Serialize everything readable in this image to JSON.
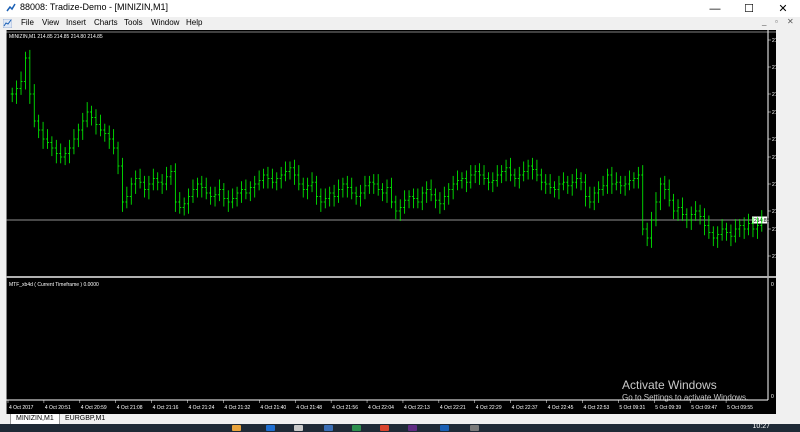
{
  "window": {
    "title": "88008: Tradize-Demo - [MINIZIN,M1]",
    "buttons": {
      "minimize": "—",
      "maximize": "☐",
      "close": "✕"
    }
  },
  "menu": {
    "items": [
      "File",
      "View",
      "Insert",
      "Charts",
      "Tools",
      "Window",
      "Help"
    ],
    "mdi": {
      "minimize": "_",
      "restore": "▫",
      "close": "✕"
    }
  },
  "chart": {
    "header": "MINIZIN,M1  214.85 214.85 214.80 214.85",
    "current_price": "214.85",
    "indicator_label": "MTF_xb4d ( Current Timeframe ) 0.0000",
    "indicator_scale_top": "0",
    "indicator_scale_bottom": "0",
    "time_labels": [
      "4 Oct 2017",
      "4 Oct 20:51",
      "4 Oct 20:59",
      "4 Oct 21:08",
      "4 Oct 21:16",
      "4 Oct 21:24",
      "4 Oct 21:32",
      "4 Oct 21:40",
      "4 Oct 21:48",
      "4 Oct 21:56",
      "4 Oct 22:04",
      "4 Oct 22:13",
      "4 Oct 22:21",
      "4 Oct 22:29",
      "4 Oct 22:37",
      "4 Oct 22:45",
      "4 Oct 22:53",
      "5 Oct 09:31",
      "5 Oct 09:39",
      "5 Oct 09:47",
      "5 Oct 09:55"
    ],
    "colors": {
      "bars": "#00ff00",
      "background": "#000000",
      "text": "#ffffff",
      "price_line": "#c0c0c0"
    }
  },
  "chart_data": {
    "type": "ohlc",
    "price_ticks": [
      "215.85",
      "215.70",
      "215.55",
      "215.45",
      "215.30",
      "215.20",
      "215.05",
      "214.90",
      "214.80",
      "214.65"
    ],
    "y_range": [
      214.55,
      215.85
    ],
    "closes": [
      215.55,
      215.58,
      215.62,
      215.75,
      215.55,
      215.4,
      215.35,
      215.3,
      215.28,
      215.25,
      215.22,
      215.2,
      215.22,
      215.25,
      215.3,
      215.35,
      215.4,
      215.45,
      215.42,
      215.38,
      215.35,
      215.33,
      215.3,
      215.25,
      215.15,
      214.95,
      214.98,
      215.05,
      215.08,
      215.06,
      215.02,
      215.05,
      215.08,
      215.06,
      215.05,
      215.09,
      215.12,
      214.95,
      214.92,
      214.94,
      214.98,
      215.02,
      215.05,
      215.03,
      215.0,
      214.98,
      214.99,
      215.02,
      214.97,
      214.95,
      214.97,
      215.0,
      215.02,
      215.0,
      215.03,
      215.05,
      215.07,
      215.1,
      215.08,
      215.06,
      215.08,
      215.1,
      215.12,
      215.14,
      215.1,
      215.05,
      215.02,
      215.04,
      215.06,
      214.98,
      214.95,
      214.97,
      215.0,
      214.98,
      215.02,
      215.05,
      215.03,
      215.0,
      214.98,
      215.0,
      215.04,
      215.06,
      215.05,
      215.02,
      215.0,
      215.03,
      214.95,
      214.9,
      214.92,
      214.96,
      214.98,
      214.97,
      214.95,
      215.0,
      215.02,
      214.99,
      214.96,
      214.94,
      214.98,
      215.02,
      215.05,
      215.07,
      215.08,
      215.06,
      215.1,
      215.12,
      215.1,
      215.08,
      215.06,
      215.07,
      215.1,
      215.12,
      215.14,
      215.1,
      215.08,
      215.1,
      215.12,
      215.15,
      215.13,
      215.1,
      215.06,
      215.05,
      215.03,
      215.02,
      215.05,
      215.06,
      215.04,
      215.06,
      215.08,
      215.06,
      214.98,
      214.95,
      215.0,
      215.02,
      215.04,
      215.1,
      215.05,
      215.06,
      215.04,
      215.05,
      215.07,
      215.08,
      215.1,
      214.8,
      214.75,
      214.85,
      214.95,
      215.05,
      215.02,
      214.96,
      214.9,
      214.92,
      214.88,
      214.85,
      214.88,
      214.9,
      214.87,
      214.82,
      214.78,
      214.75,
      214.77,
      214.8,
      214.78,
      214.76,
      214.8,
      214.82,
      214.8,
      214.83,
      214.8,
      214.82,
      214.85
    ]
  },
  "watermark": {
    "title": "Activate Windows",
    "subtitle": "Go to Settings to activate Windows."
  },
  "tabs": [
    "MINIZIN,M1",
    "EURGBP,M1"
  ],
  "taskbar": {
    "clock": "10:27"
  }
}
